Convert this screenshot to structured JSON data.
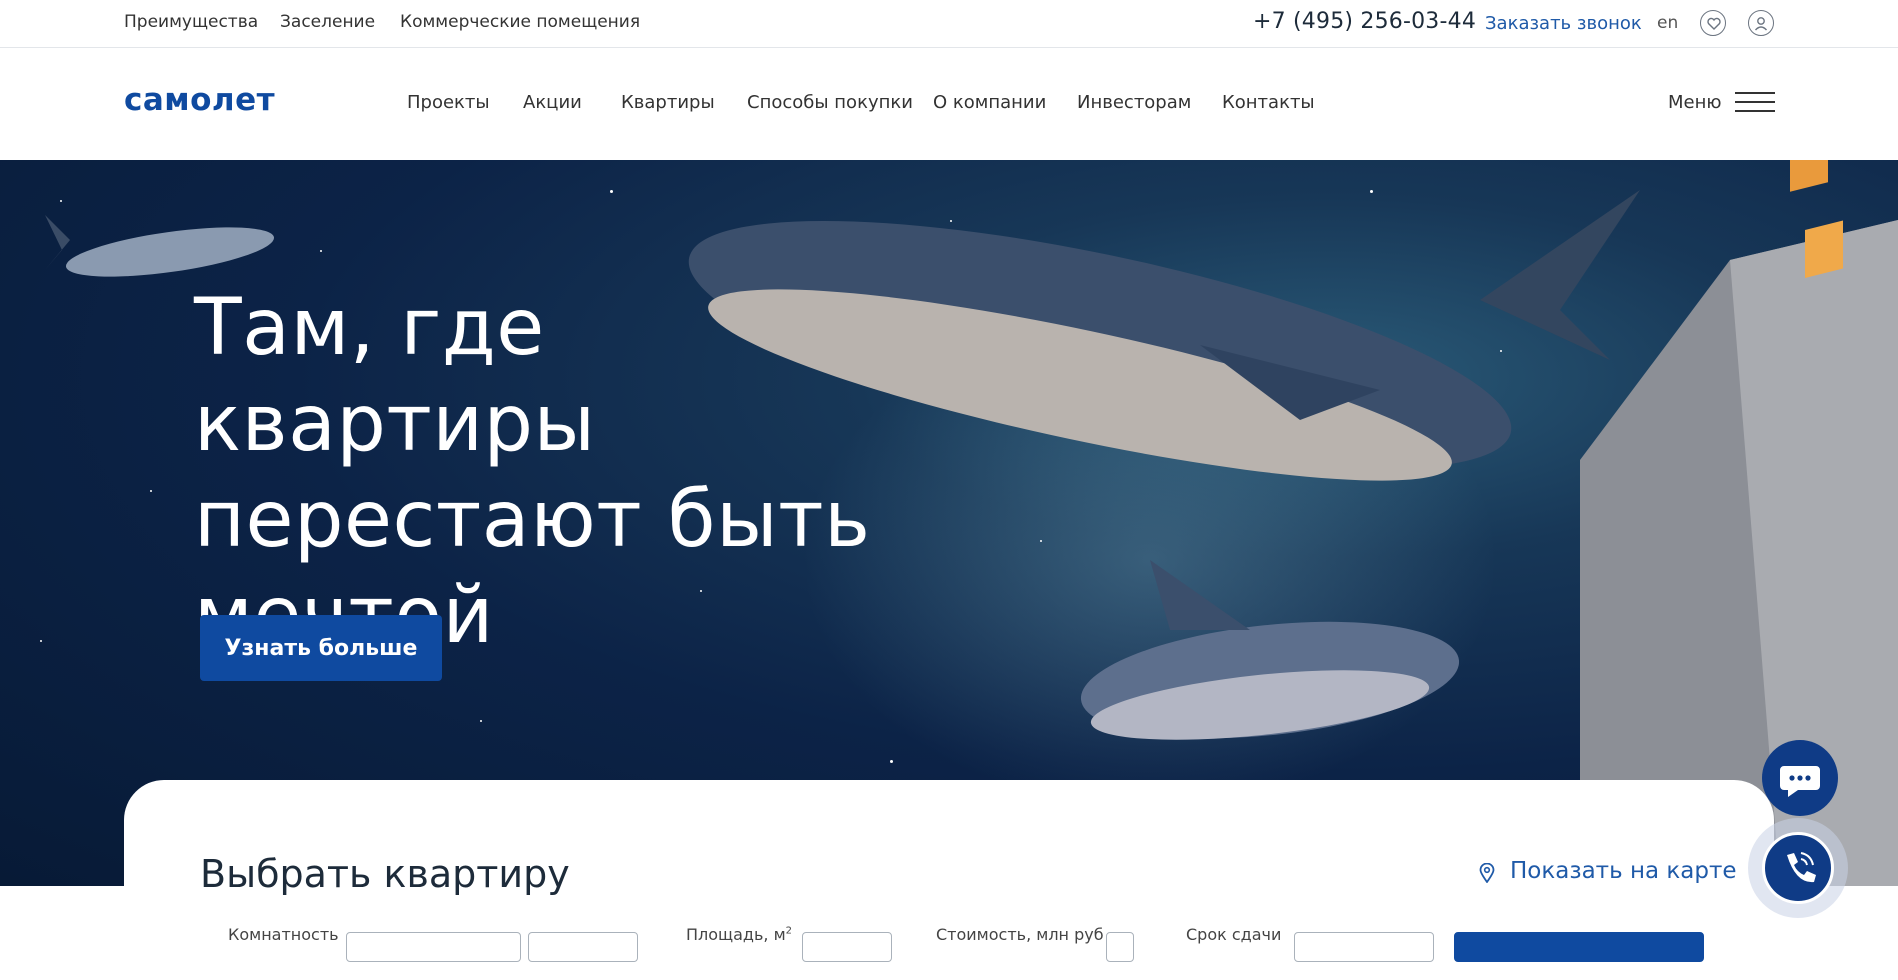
{
  "topbar": {
    "links": [
      "Преимущества",
      "Заселение",
      "Коммерческие помещения"
    ],
    "phone": "+7 (495) 256-03-44",
    "callback": "Заказать звонок",
    "lang": "en"
  },
  "header": {
    "logo": "самолет",
    "nav": [
      "Проекты",
      "Акции",
      "Квартиры",
      "Способы покупки",
      "О компании",
      "Инвесторам",
      "Контакты"
    ],
    "menu_label": "Меню"
  },
  "hero": {
    "headline_lines": [
      "Там, где квартиры",
      "перестают быть",
      "мечтой"
    ],
    "cta": "Узнать больше"
  },
  "search": {
    "title": "Выбрать квартиру",
    "map_link": "Показать на карте",
    "filters": [
      "Комнатность",
      "Площадь, м",
      "Стоимость, млн руб",
      "Срок сдачи"
    ],
    "area_superscript": "2"
  },
  "colors": {
    "brand": "#0f4aa0",
    "link": "#1f5aa8",
    "fab": "#0f3b86"
  }
}
